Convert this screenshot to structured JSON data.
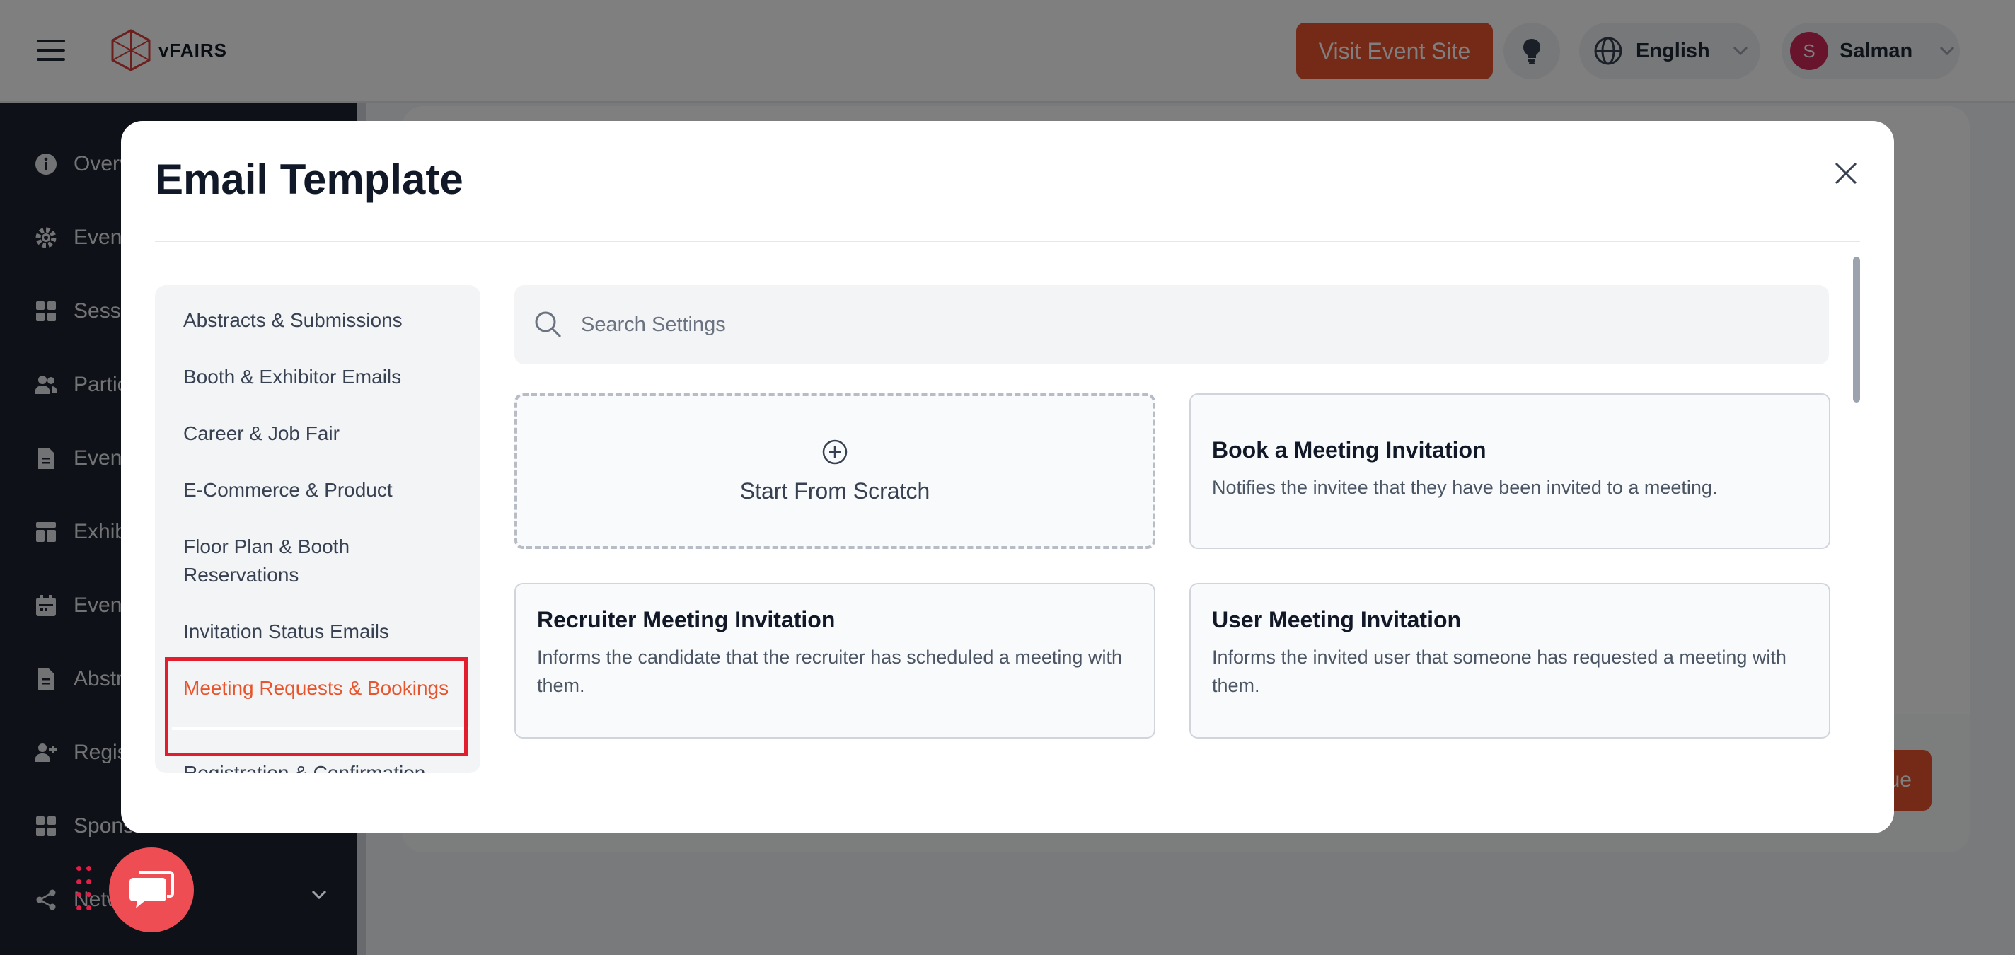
{
  "topbar": {
    "logo_text": "vFAIRS",
    "visit_button": "Visit Event Site",
    "language": "English",
    "user_initial": "S",
    "user_name": "Salman"
  },
  "sidebar": {
    "items": [
      {
        "label": "Overv",
        "icon": "info-icon"
      },
      {
        "label": "Event",
        "icon": "gear-icon"
      },
      {
        "label": "Sessio",
        "icon": "grid-icon"
      },
      {
        "label": "Partic",
        "icon": "users-icon"
      },
      {
        "label": "Event",
        "icon": "document-icon"
      },
      {
        "label": "Exhib",
        "icon": "layout-icon"
      },
      {
        "label": "Event",
        "icon": "calendar-icon"
      },
      {
        "label": "Abstr",
        "icon": "document-icon"
      },
      {
        "label": "Regis",
        "icon": "user-plus-icon"
      },
      {
        "label": "Spons",
        "icon": "grid-icon"
      },
      {
        "label": "Netw",
        "icon": "share-icon"
      }
    ]
  },
  "background": {
    "continue_fragment": "ue"
  },
  "modal": {
    "title": "Email Template",
    "categories": [
      {
        "label": "Abstracts & Submissions",
        "active": false
      },
      {
        "label": "Booth & Exhibitor Emails",
        "active": false
      },
      {
        "label": "Career & Job Fair",
        "active": false
      },
      {
        "label": "E-Commerce & Product",
        "active": false
      },
      {
        "label": "Floor Plan & Booth Reservations",
        "active": false
      },
      {
        "label": "Invitation Status Emails",
        "active": false
      },
      {
        "label": "Meeting Requests & Bookings",
        "active": true
      },
      {
        "label": "Registration & Confirmation",
        "active": false
      }
    ],
    "search_placeholder": "Search Settings",
    "scratch_label": "Start From Scratch",
    "templates": [
      {
        "title": "Book a Meeting Invitation",
        "description": "Notifies the invitee that they have been invited to a meeting."
      },
      {
        "title": "Recruiter Meeting Invitation",
        "description": "Informs the candidate that the recruiter has scheduled a meeting with them."
      },
      {
        "title": "User Meeting Invitation",
        "description": "Informs the invited user that someone has requested a meeting with them."
      }
    ]
  },
  "colors": {
    "accent": "#e8552d",
    "highlight_border": "#e11d2e",
    "sidebar_bg": "#1f2330",
    "chat_button": "#ef4d54"
  }
}
